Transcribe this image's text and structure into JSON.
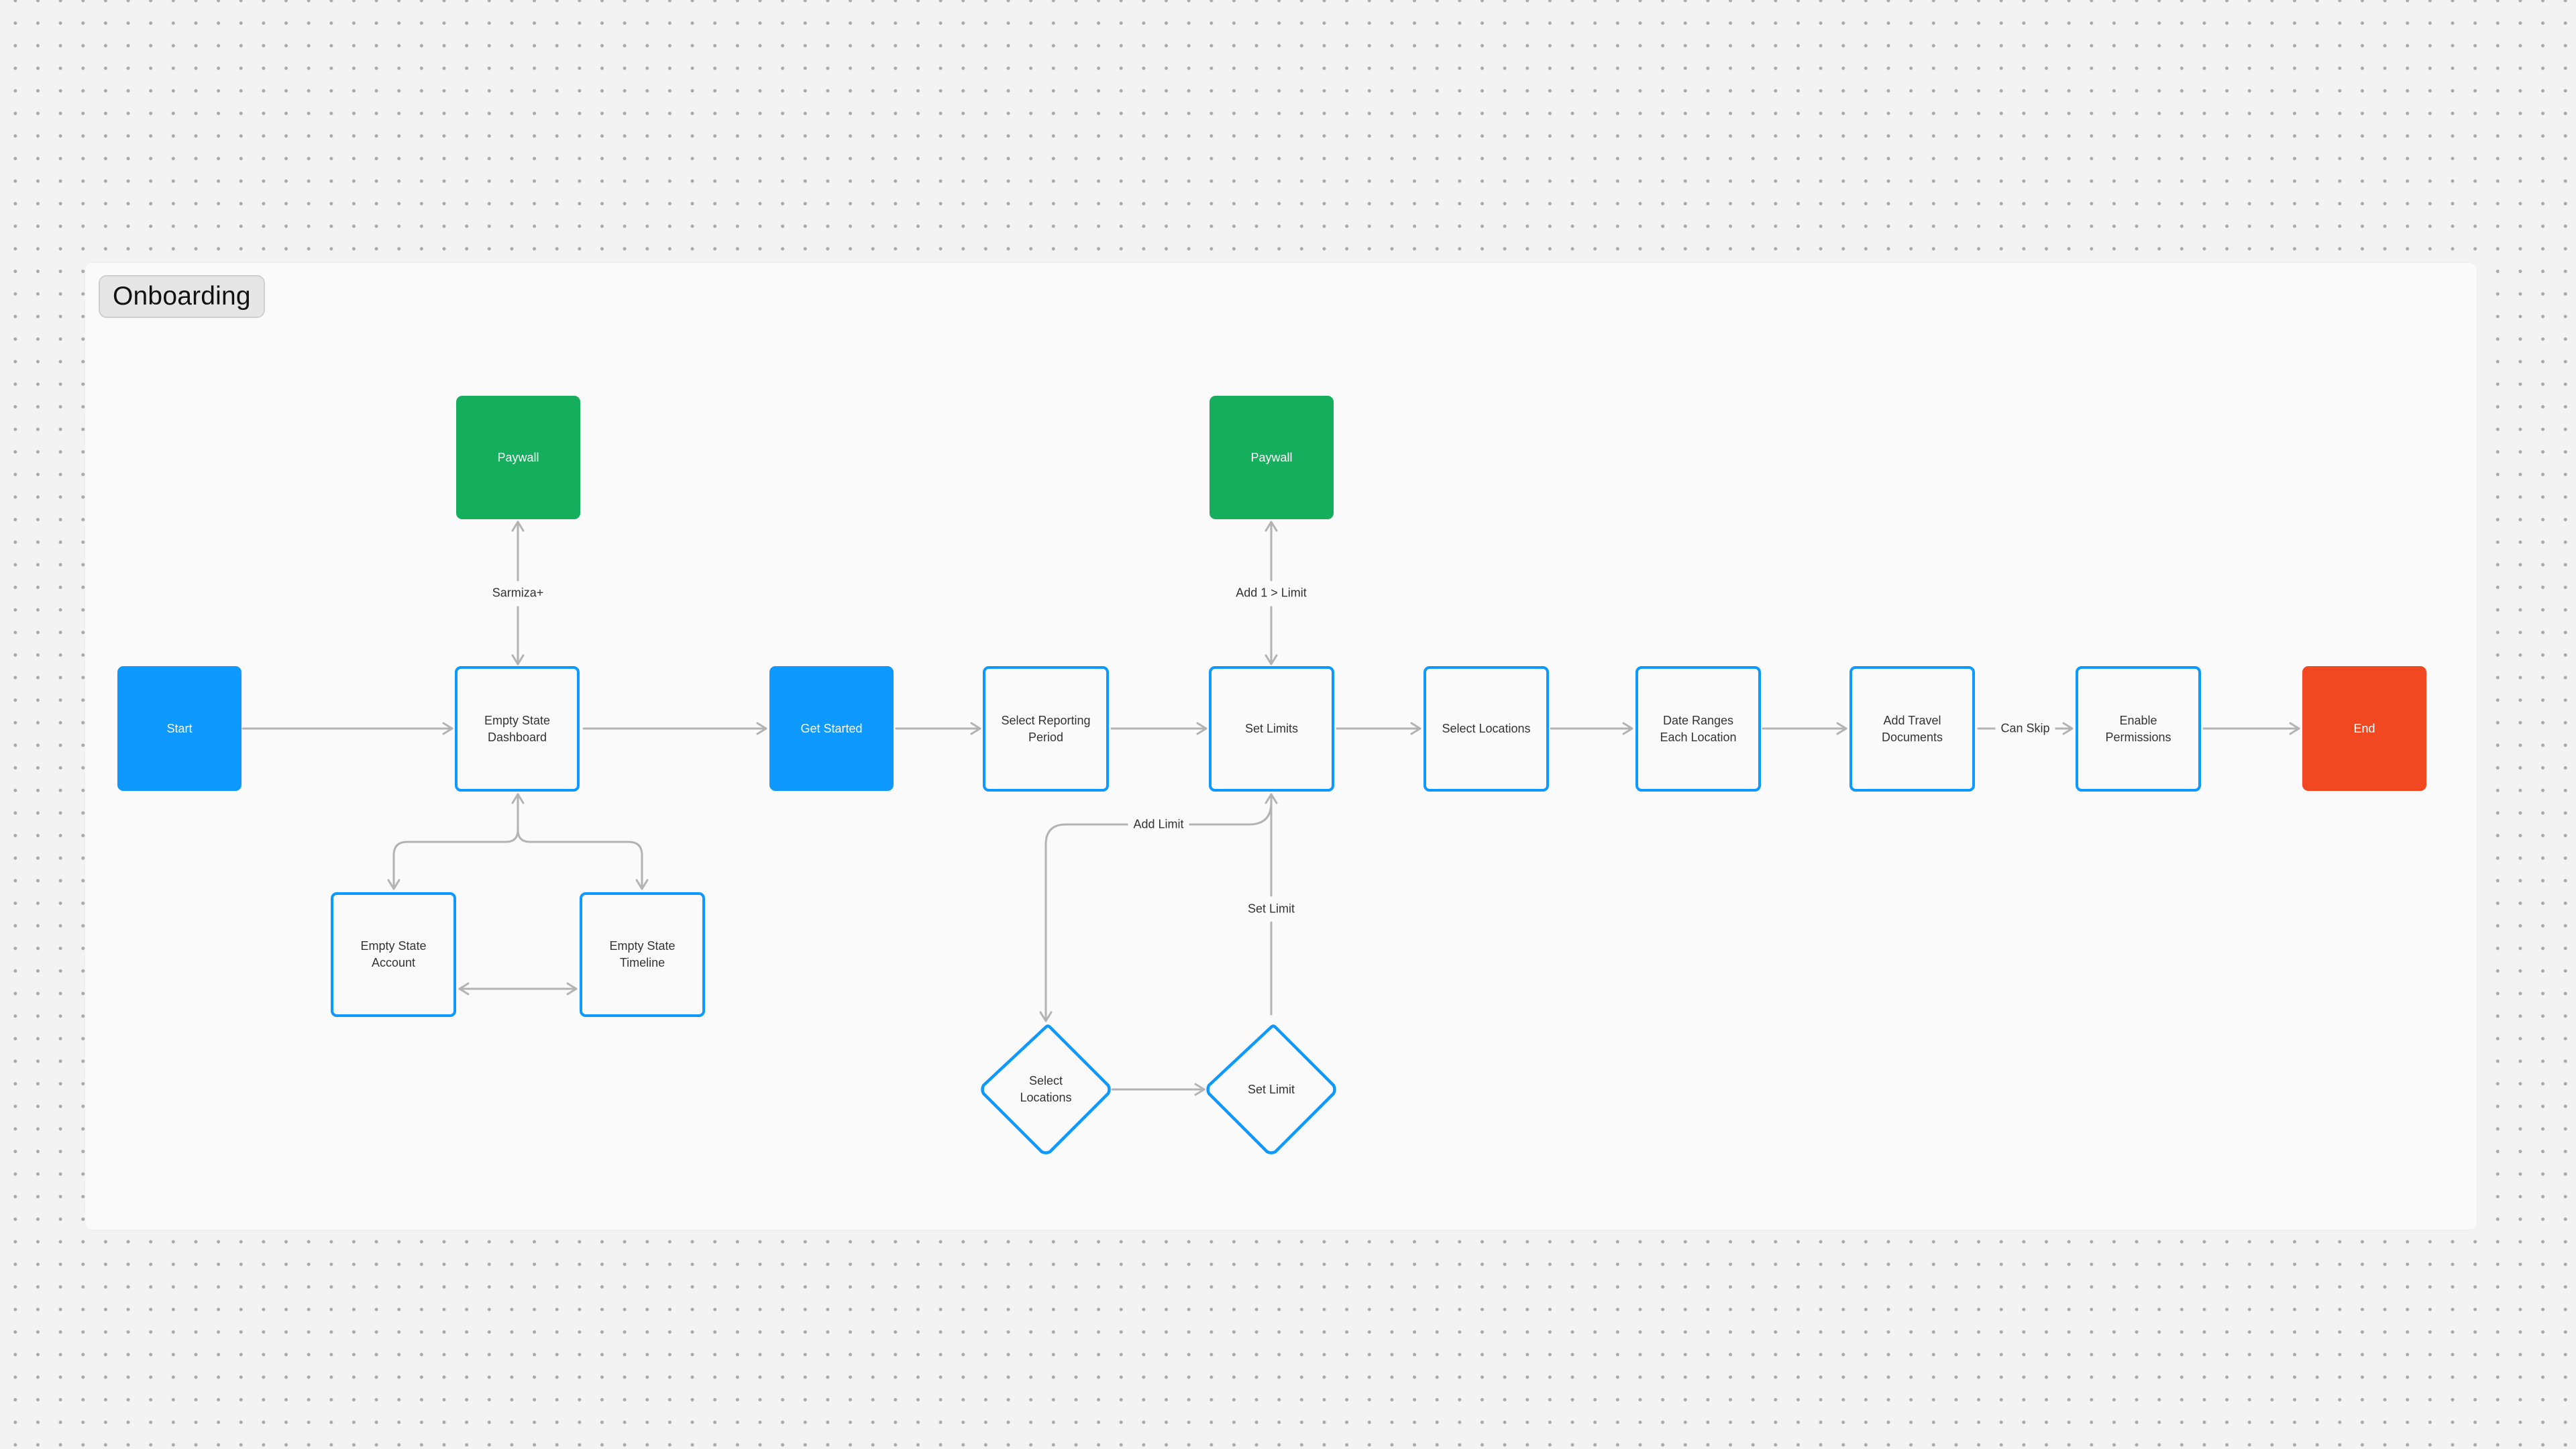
{
  "section": {
    "title": "Onboarding"
  },
  "colors": {
    "blue": "#0d99ff",
    "green": "#14ae5c",
    "red": "#f24822",
    "connector": "#b3b3b3",
    "frame": "#fafafa",
    "canvas": "#f3f3f3"
  },
  "nodes": {
    "start": {
      "label": "Start",
      "shape": "rectangle",
      "style": "filled-blue"
    },
    "paywall_1": {
      "label": "Paywall",
      "shape": "rectangle",
      "style": "filled-green"
    },
    "empty_state_dashboard": {
      "label": "Empty State Dashboard",
      "shape": "rectangle",
      "style": "outlined"
    },
    "empty_state_account": {
      "label": "Empty State Account",
      "shape": "rectangle",
      "style": "outlined"
    },
    "empty_state_timeline": {
      "label": "Empty State Timeline",
      "shape": "rectangle",
      "style": "outlined"
    },
    "get_started": {
      "label": "Get Started",
      "shape": "rectangle",
      "style": "filled-blue"
    },
    "select_reporting_period": {
      "label": "Select Reporting Period",
      "shape": "rectangle",
      "style": "outlined"
    },
    "set_limits": {
      "label": "Set Limits",
      "shape": "rectangle",
      "style": "outlined"
    },
    "paywall_2": {
      "label": "Paywall",
      "shape": "rectangle",
      "style": "filled-green"
    },
    "select_locations": {
      "label": "Select Locations",
      "shape": "rectangle",
      "style": "outlined"
    },
    "date_ranges_each_location": {
      "label": "Date Ranges Each Location",
      "shape": "rectangle",
      "style": "outlined"
    },
    "add_travel_documents": {
      "label": "Add Travel Documents",
      "shape": "rectangle",
      "style": "outlined"
    },
    "enable_permissions": {
      "label": "Enable Permissions",
      "shape": "rectangle",
      "style": "outlined"
    },
    "end": {
      "label": "End",
      "shape": "rectangle",
      "style": "filled-red"
    },
    "decision_select_locations": {
      "label": "Select Locations",
      "shape": "diamond",
      "style": "outlined"
    },
    "decision_set_limit": {
      "label": "Set Limit",
      "shape": "diamond",
      "style": "outlined"
    }
  },
  "edges": [
    {
      "from": "start",
      "to": "empty_state_dashboard",
      "label": ""
    },
    {
      "from": "empty_state_dashboard",
      "to": "paywall_1",
      "label": "Sarmiza+",
      "bidirectional": true
    },
    {
      "from": "empty_state_dashboard",
      "to": "empty_state_account",
      "label": "",
      "bidirectional": true
    },
    {
      "from": "empty_state_dashboard",
      "to": "empty_state_timeline",
      "label": "",
      "bidirectional": true
    },
    {
      "from": "empty_state_account",
      "to": "empty_state_timeline",
      "label": "",
      "bidirectional": true
    },
    {
      "from": "empty_state_dashboard",
      "to": "get_started",
      "label": ""
    },
    {
      "from": "get_started",
      "to": "select_reporting_period",
      "label": ""
    },
    {
      "from": "select_reporting_period",
      "to": "set_limits",
      "label": ""
    },
    {
      "from": "set_limits",
      "to": "paywall_2",
      "label": "Add 1 > Limit",
      "bidirectional": true
    },
    {
      "from": "set_limits",
      "to": "decision_select_locations",
      "label": "Add Limit"
    },
    {
      "from": "decision_select_locations",
      "to": "decision_set_limit",
      "label": ""
    },
    {
      "from": "decision_set_limit",
      "to": "set_limits",
      "label": "Set Limit"
    },
    {
      "from": "set_limits",
      "to": "select_locations",
      "label": ""
    },
    {
      "from": "select_locations",
      "to": "date_ranges_each_location",
      "label": ""
    },
    {
      "from": "date_ranges_each_location",
      "to": "add_travel_documents",
      "label": ""
    },
    {
      "from": "add_travel_documents",
      "to": "enable_permissions",
      "label": "Can Skip"
    },
    {
      "from": "enable_permissions",
      "to": "end",
      "label": ""
    }
  ]
}
